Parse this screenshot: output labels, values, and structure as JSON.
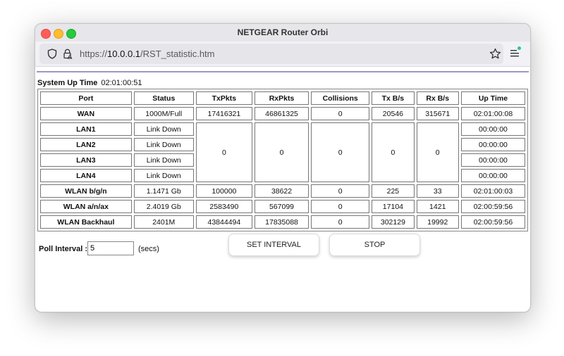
{
  "window": {
    "title": "NETGEAR Router Orbi"
  },
  "toolbar": {
    "url_prefix": "https://",
    "url_host": "10.0.0.1",
    "url_path": "/RST_statistic.htm"
  },
  "page": {
    "uptime_label": "System Up Time",
    "uptime_value": "02:01:00:51",
    "columns": [
      "Port",
      "Status",
      "TxPkts",
      "RxPkts",
      "Collisions",
      "Tx B/s",
      "Rx B/s",
      "Up Time"
    ],
    "wan": {
      "port": "WAN",
      "status": "1000M/Full",
      "txpkts": "17416321",
      "rxpkts": "46861325",
      "collisions": "0",
      "txbs": "20546",
      "rxbs": "315671",
      "uptime": "02:01:00:08"
    },
    "lan_shared": {
      "txpkts": "0",
      "rxpkts": "0",
      "collisions": "0",
      "txbs": "0",
      "rxbs": "0"
    },
    "lan": [
      {
        "port": "LAN1",
        "status": "Link Down",
        "uptime": "00:00:00"
      },
      {
        "port": "LAN2",
        "status": "Link Down",
        "uptime": "00:00:00"
      },
      {
        "port": "LAN3",
        "status": "Link Down",
        "uptime": "00:00:00"
      },
      {
        "port": "LAN4",
        "status": "Link Down",
        "uptime": "00:00:00"
      }
    ],
    "wlan": [
      {
        "port": "WLAN b/g/n",
        "status": "1.1471 Gb",
        "txpkts": "100000",
        "rxpkts": "38622",
        "collisions": "0",
        "txbs": "225",
        "rxbs": "33",
        "uptime": "02:01:00:03"
      },
      {
        "port": "WLAN a/n/ax",
        "status": "2.4019 Gb",
        "txpkts": "2583490",
        "rxpkts": "567099",
        "collisions": "0",
        "txbs": "17104",
        "rxbs": "1421",
        "uptime": "02:00:59:56"
      },
      {
        "port": "WLAN Backhaul",
        "status": "2401M",
        "txpkts": "43844494",
        "rxpkts": "17835088",
        "collisions": "0",
        "txbs": "302129",
        "rxbs": "19992",
        "uptime": "02:00:59:56"
      }
    ],
    "poll_label": "Poll Interval :",
    "poll_value": "5",
    "poll_unit": "(secs)",
    "set_interval_label": "SET INTERVAL",
    "stop_label": "STOP"
  },
  "icons": {
    "shield": "shield-icon",
    "lock": "lock-warning-icon",
    "star": "star-bookmark-icon",
    "menu": "hamburger-menu-icon"
  },
  "colors": {
    "accent_line": "#9b98c2",
    "menu_badge": "#2ac3a2"
  }
}
